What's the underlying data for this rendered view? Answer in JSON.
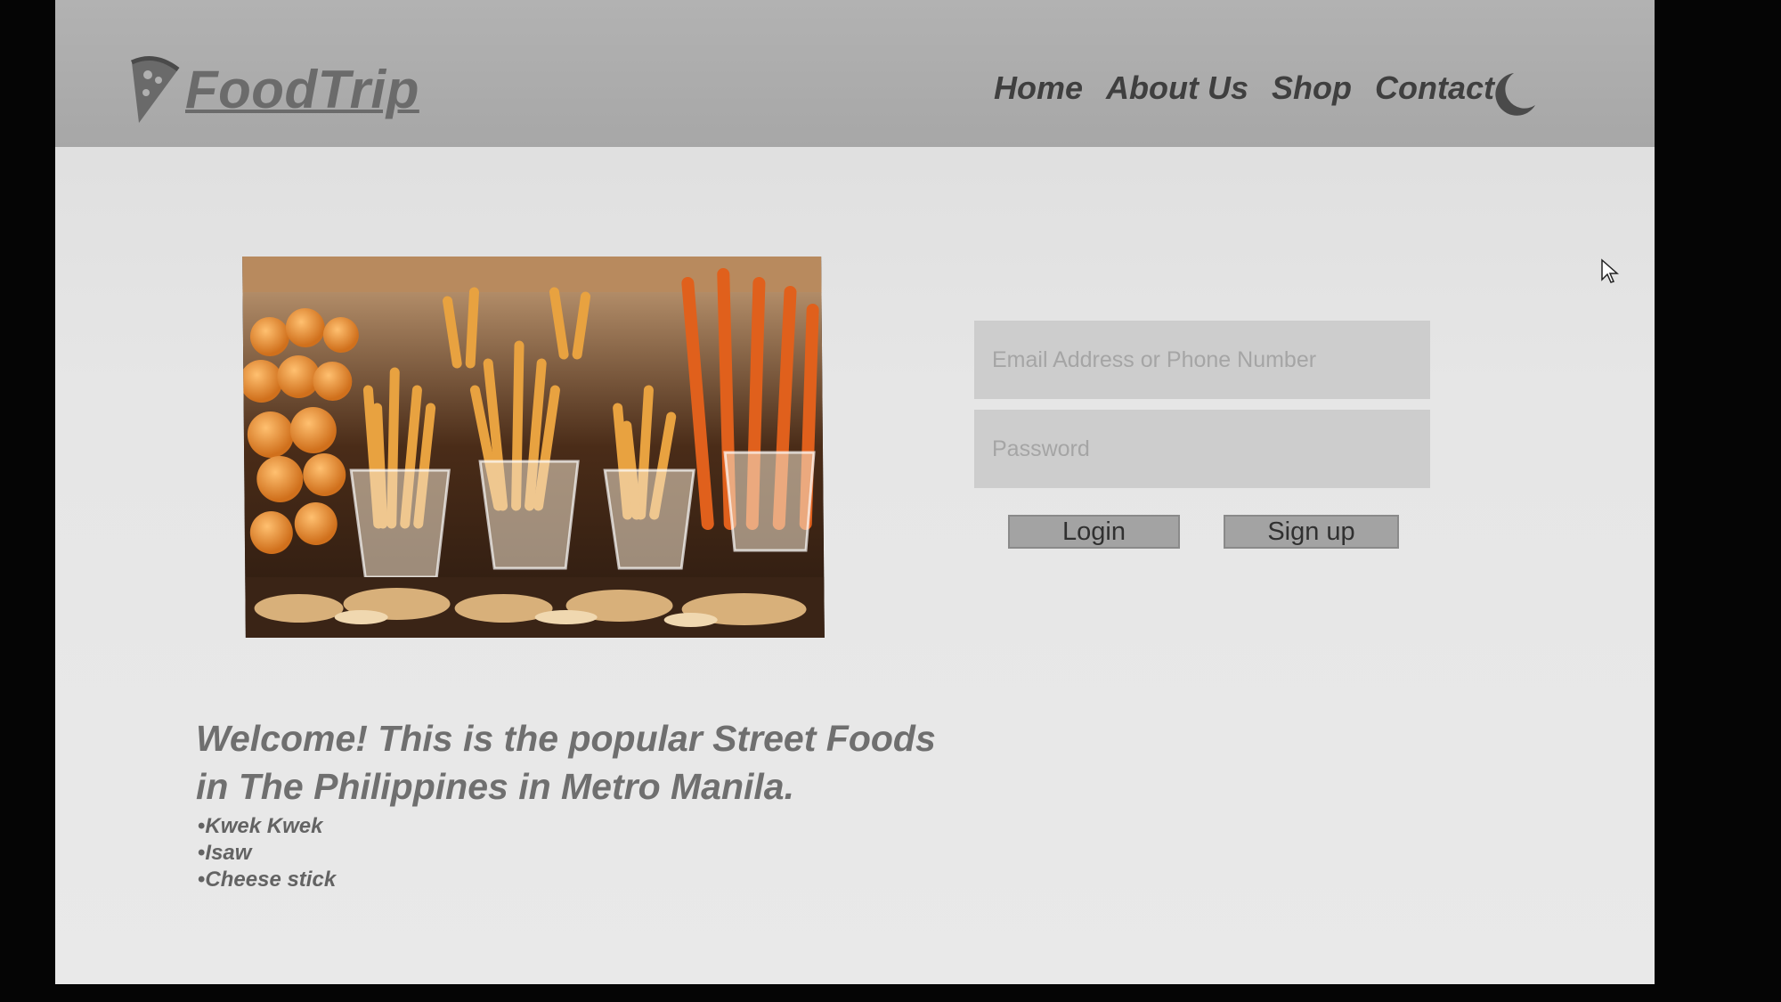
{
  "brand": {
    "name": "FoodTrip",
    "logo_icon": "pizza-slice-icon"
  },
  "nav": {
    "items": [
      {
        "label": "Home"
      },
      {
        "label": "About Us"
      },
      {
        "label": "Shop"
      },
      {
        "label": "Contact"
      }
    ],
    "theme_toggle_icon": "moon-icon"
  },
  "hero": {
    "image_icon": "street-food-photo"
  },
  "login_form": {
    "email_placeholder": "Email Address or Phone Number",
    "email_value": "",
    "password_placeholder": "Password",
    "password_value": "",
    "login_label": "Login",
    "signup_label": "Sign up"
  },
  "welcome": {
    "heading_line1": "Welcome! This is the popular Street Foods",
    "heading_line2": "in The Philippines in Metro Manila.",
    "items": [
      "Kwek Kwek",
      "Isaw",
      "Cheese stick"
    ]
  },
  "colors": {
    "navbar": "#aaaaaa",
    "page_background": "#e4e4e4",
    "input_background": "#cdcdcd",
    "button_background": "#a3a3a3",
    "heading_text": "#6f6f6f"
  }
}
